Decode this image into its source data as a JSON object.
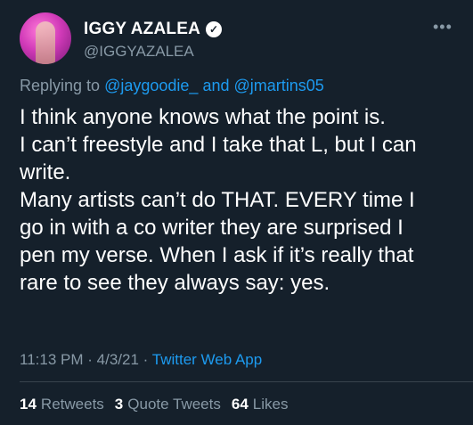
{
  "author": {
    "display_name": "IGGY AZALEA",
    "verified_glyph": "✓",
    "handle": "@IGGYAZALEA",
    "more_glyph": "•••"
  },
  "reply": {
    "prefix": "Replying to",
    "user1": "@jaygoodie_",
    "and": "and",
    "user2": "@jmartins05"
  },
  "tweet_lines": [
    "I think anyone knows what the point is.",
    "I can’t freestyle and I take that L, but I can",
    "write.",
    "Many artists can’t do THAT. EVERY time I",
    "go in with a co writer they are surprised I",
    "pen my verse. When I ask if it’s really that",
    "rare to see they always say: yes."
  ],
  "meta": {
    "time": "11:13 PM",
    "sep1": "·",
    "date": "4/3/21",
    "sep2": "·",
    "source": "Twitter Web App"
  },
  "stats": {
    "retweets_count": "14",
    "retweets_label": "Retweets",
    "quotes_count": "3",
    "quotes_label": "Quote Tweets",
    "likes_count": "64",
    "likes_label": "Likes"
  },
  "colors": {
    "background": "#15202b",
    "link": "#1d9bf0",
    "secondary_text": "#8899a6"
  }
}
